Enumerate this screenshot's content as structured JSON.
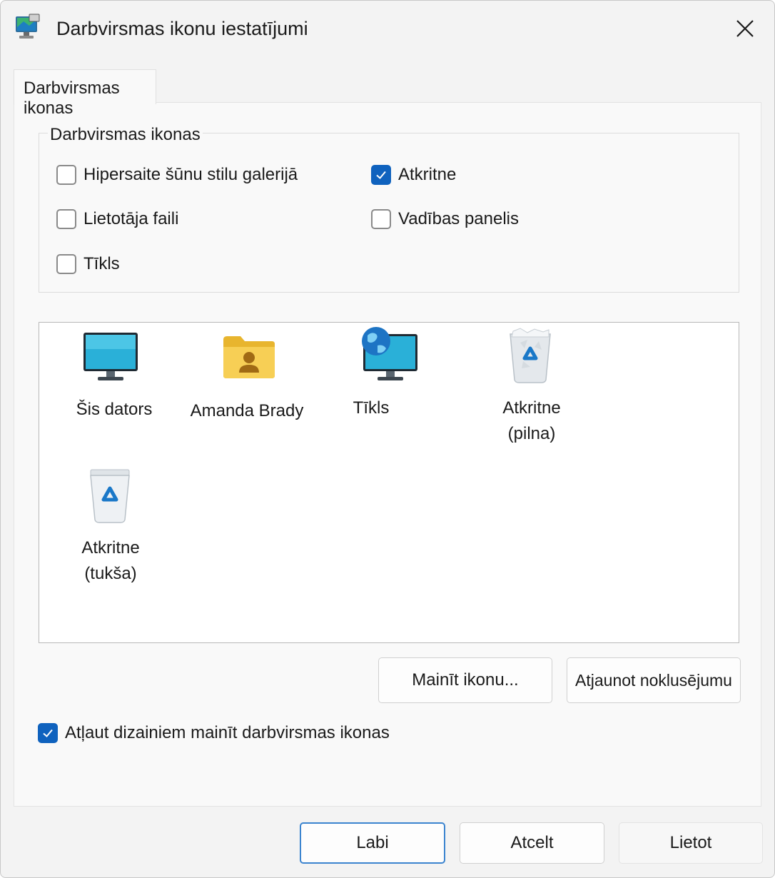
{
  "window": {
    "title": "Darbvirsmas ikonu iestatījumi",
    "app_icon": "desktop-settings-icon",
    "close_icon": "close-icon"
  },
  "tabs": [
    {
      "label": "Darbvirsmas ikonas",
      "active": true
    }
  ],
  "group": {
    "title": "Darbvirsmas ikonas",
    "checkboxes": [
      {
        "label": "Hipersaite šūnu stilu galerijā",
        "checked": false
      },
      {
        "label": "Atkritne",
        "checked": true
      },
      {
        "label": "Lietotāja faili",
        "checked": false
      },
      {
        "label": "Vadības panelis",
        "checked": false
      },
      {
        "label": "Tīkls",
        "checked": false
      }
    ]
  },
  "icon_list": [
    {
      "label": "Šis dators",
      "icon": "monitor-icon"
    },
    {
      "label": "Amanda Brady",
      "icon": "user-folder-icon"
    },
    {
      "label": "Tīkls",
      "icon": "network-globe-monitor-icon"
    },
    {
      "label_line1": "Atkritne",
      "label_line2": "(pilna)",
      "icon": "recycle-bin-full-icon"
    },
    {
      "label_line1": "Atkritne",
      "label_line2": "(tukša)",
      "icon": "recycle-bin-empty-icon"
    }
  ],
  "buttons": {
    "change_icon": "Mainīt ikonu...",
    "restore_default": "Atjaunot noklusējumu"
  },
  "allow_themes": {
    "label": "Atļaut dizainiem mainīt darbvirsmas ikonas",
    "checked": true
  },
  "dialog_buttons": {
    "ok": "Labi",
    "cancel": "Atcelt",
    "apply": "Lietot"
  },
  "colors": {
    "accent": "#0f62be",
    "window_bg": "#f3f3f3",
    "panel_bg": "#f9f9f9"
  }
}
